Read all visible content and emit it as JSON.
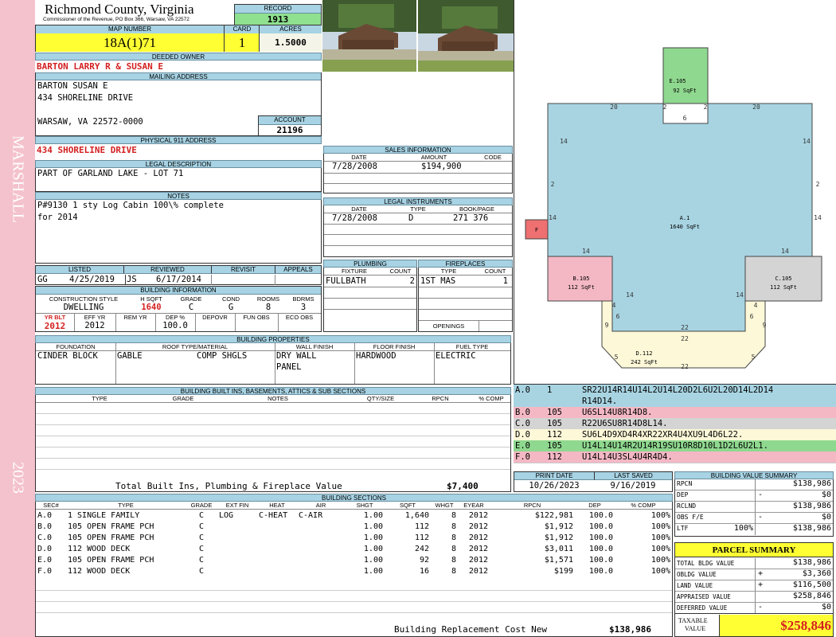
{
  "side": {
    "district": "MARSHALL",
    "year": "2023"
  },
  "header": {
    "county": "Richmond County, Virginia",
    "commissioner": "Commissioner of the Revenue, PO Box 366, Warsaw, VA 22572"
  },
  "record": {
    "label": "RECORD",
    "value": "1913"
  },
  "map": {
    "label": "MAP NUMBER",
    "value": "18A(1)71"
  },
  "card": {
    "label": "CARD",
    "value": "1"
  },
  "acres": {
    "label": "ACRES",
    "value": "1.5000"
  },
  "owner": {
    "label": "DEEDED OWNER",
    "value": "BARTON LARRY R & SUSAN E"
  },
  "mailing": {
    "label": "MAILING ADDRESS",
    "line1": "BARTON SUSAN E",
    "line2": "434 SHORELINE DRIVE",
    "line3": "WARSAW, VA 22572-0000"
  },
  "account": {
    "label": "ACCOUNT",
    "value": "21196"
  },
  "physical": {
    "label": "PHYSICAL 911 ADDRESS",
    "value": "434 SHORELINE DRIVE"
  },
  "legal": {
    "label": "LEGAL DESCRIPTION",
    "value": "PART OF GARLAND LAKE - LOT 71"
  },
  "notes": {
    "label": "NOTES",
    "line1": "P#9130 1 sty Log Cabin 100\\% complete",
    "line2": "for 2014"
  },
  "listing": {
    "headers": [
      "LISTED",
      "REVIEWED",
      "REVISIT",
      "APPEALS"
    ],
    "listed_by": "GG",
    "listed_date": "4/25/2019",
    "reviewed_by": "JS",
    "reviewed_date": "6/17/2014"
  },
  "building_info": {
    "title": "BUILDING INFORMATION",
    "headers": [
      "CONSTRUCTION STYLE",
      "H SQFT",
      "GRADE",
      "COND",
      "ROOMS",
      "BDRMS"
    ],
    "values": [
      "DWELLING",
      "1640",
      "C",
      "G",
      "8",
      "3"
    ],
    "headers2": [
      "YR BLT",
      "EFF YR",
      "REM YR",
      "DEP %",
      "DEPOVR",
      "FUN OBS",
      "ECO OBS"
    ],
    "values2": [
      "2012",
      "2012",
      "",
      "100.0",
      "",
      "",
      ""
    ]
  },
  "sales": {
    "title": "SALES INFORMATION",
    "headers": [
      "DATE",
      "AMOUNT",
      "CODE"
    ],
    "date": "7/28/2008",
    "amount": "$194,900",
    "code": ""
  },
  "instruments": {
    "title": "LEGAL INSTRUMENTS",
    "headers": [
      "DATE",
      "TYPE",
      "BOOK/PAGE"
    ],
    "date": "7/28/2008",
    "type": "D",
    "bookpage": "271 376"
  },
  "plumbing": {
    "title": "PLUMBING",
    "headers": [
      "FIXTURE",
      "COUNT"
    ],
    "fixture": "FULLBATH",
    "count": "2"
  },
  "fireplaces": {
    "title": "FIREPLACES",
    "headers": [
      "TYPE",
      "COUNT"
    ],
    "type": "1ST MAS",
    "count": "1",
    "openings": "OPENINGS"
  },
  "properties": {
    "title": "BUILDING PROPERTIES",
    "headers": [
      "FOUNDATION",
      "ROOF TYPE/MATERIAL",
      "WALL FINISH",
      "FLOOR FINISH",
      "FUEL TYPE"
    ],
    "foundation": "CINDER BLOCK",
    "roof_type": "GABLE",
    "roof_material": "COMP SHGLS",
    "wall1": "DRY WALL",
    "wall2": "PANEL",
    "floor": "HARDWOOD",
    "fuel": "ELECTRIC"
  },
  "builtins": {
    "title": "BUILDING BUILT INS, BASEMENTS, ATTICS & SUB SECTIONS",
    "headers": [
      "TYPE",
      "GRADE",
      "NOTES",
      "QTY/SIZE",
      "RPCN",
      "% COMP"
    ],
    "total_label": "Total Built Ins, Plumbing & Fireplace Value",
    "total_value": "$7,400"
  },
  "sketch": {
    "sections": [
      {
        "label": "A.1",
        "area": "1640 SqFt"
      },
      {
        "label": "B.105",
        "area": "112 SqFt"
      },
      {
        "label": "C.105",
        "area": "112 SqFt"
      },
      {
        "label": "D.112",
        "area": "242 SqFt"
      },
      {
        "label": "E.105",
        "area": "92 SqFt"
      },
      {
        "label": "F",
        "area": ""
      }
    ],
    "dims": {
      "d20": "20",
      "d2": "2",
      "d6": "6",
      "d14": "14",
      "d4": "4",
      "d9": "9",
      "d5": "5",
      "d22": "22"
    }
  },
  "vectors": [
    {
      "sec": "A.0",
      "code": "1",
      "vec": "SR22U14R14U14L2U14L20D2L6U2L20D14L2D14",
      "vec2": "R14D14.",
      "color": "#a8d4e2"
    },
    {
      "sec": "B.0",
      "code": "105",
      "vec": "U6SL14U8R14D8.",
      "color": "#f4b8c4"
    },
    {
      "sec": "C.0",
      "code": "105",
      "vec": "R22U6SU8R14D8L14.",
      "color": "#d4d4d4"
    },
    {
      "sec": "D.0",
      "code": "112",
      "vec": "SU6L4D9XD4R4XR22XR4U4XU9L4D6L22.",
      "color": "#fcf8d8"
    },
    {
      "sec": "E.0",
      "code": "105",
      "vec": "U14L14U14R2U14R19SU10R8D10L1D2L6U2L1.",
      "color": "#8fd88f"
    },
    {
      "sec": "F.0",
      "code": "112",
      "vec": "U14L14U3SL4U4R4D4.",
      "color": "#f4b8c4"
    }
  ],
  "print": {
    "print_label": "PRINT DATE",
    "print_date": "10/26/2023",
    "saved_label": "LAST SAVED",
    "saved_date": "9/16/2019"
  },
  "sections_table": {
    "title": "BUILDING SECTIONS",
    "headers": [
      "SEC#",
      "TYPE",
      "GRADE",
      "EXT FIN",
      "HEAT",
      "AIR",
      "SHGT",
      "SQFT",
      "WHGT",
      "EYEAR",
      "RPCN",
      "DEP",
      "% COMP"
    ],
    "rows": [
      [
        "A.0",
        "1 SINGLE FAMILY",
        "C",
        "LOG",
        "C-HEAT",
        "C-AIR",
        "1.00",
        "1,640",
        "8",
        "2012",
        "$122,981",
        "100.0",
        "100%"
      ],
      [
        "B.0",
        "105 OPEN FRAME PCH",
        "C",
        "",
        "",
        "",
        "1.00",
        "112",
        "8",
        "2012",
        "$1,912",
        "100.0",
        "100%"
      ],
      [
        "C.0",
        "105 OPEN FRAME PCH",
        "C",
        "",
        "",
        "",
        "1.00",
        "112",
        "8",
        "2012",
        "$1,912",
        "100.0",
        "100%"
      ],
      [
        "D.0",
        "112 WOOD DECK",
        "C",
        "",
        "",
        "",
        "1.00",
        "242",
        "8",
        "2012",
        "$3,011",
        "100.0",
        "100%"
      ],
      [
        "E.0",
        "105 OPEN FRAME PCH",
        "C",
        "",
        "",
        "",
        "1.00",
        "92",
        "8",
        "2012",
        "$1,571",
        "100.0",
        "100%"
      ],
      [
        "F.0",
        "112 WOOD DECK",
        "C",
        "",
        "",
        "",
        "1.00",
        "16",
        "8",
        "2012",
        "$199",
        "100.0",
        "100%"
      ]
    ],
    "rcn_label": "Building Replacement Cost New",
    "rcn_value": "$138,986"
  },
  "value_summary": {
    "title": "BUILDING VALUE SUMMARY",
    "rpcn_label": "RPCN",
    "rpcn": "$138,986",
    "dep_label": "DEP",
    "dep_sign": "-",
    "dep": "$0",
    "rclnd_label": "RCLND",
    "rclnd": "$138,986",
    "obs_label": "OBS F/E",
    "obs_sign": "-",
    "obs": "$0",
    "ltf_label": "LTF",
    "ltf_pct": "100%",
    "ltf": "$138,986"
  },
  "parcel": {
    "title": "PARCEL SUMMARY",
    "bldg_label": "TOTAL BLDG VALUE",
    "bldg": "$138,986",
    "obldg_label": "OBLDG VALUE",
    "obldg_sign": "+",
    "obldg": "$3,360",
    "land_label": "LAND VALUE",
    "land_sign": "+",
    "land": "$116,500",
    "appraised_label": "APPRAISED VALUE",
    "appraised": "$258,846",
    "deferred_label": "DEFERRED VALUE",
    "deferred_sign": "-",
    "deferred": "$0",
    "taxable_label1": "TAXABLE",
    "taxable_label2": "VALUE",
    "taxable": "$258,846"
  }
}
